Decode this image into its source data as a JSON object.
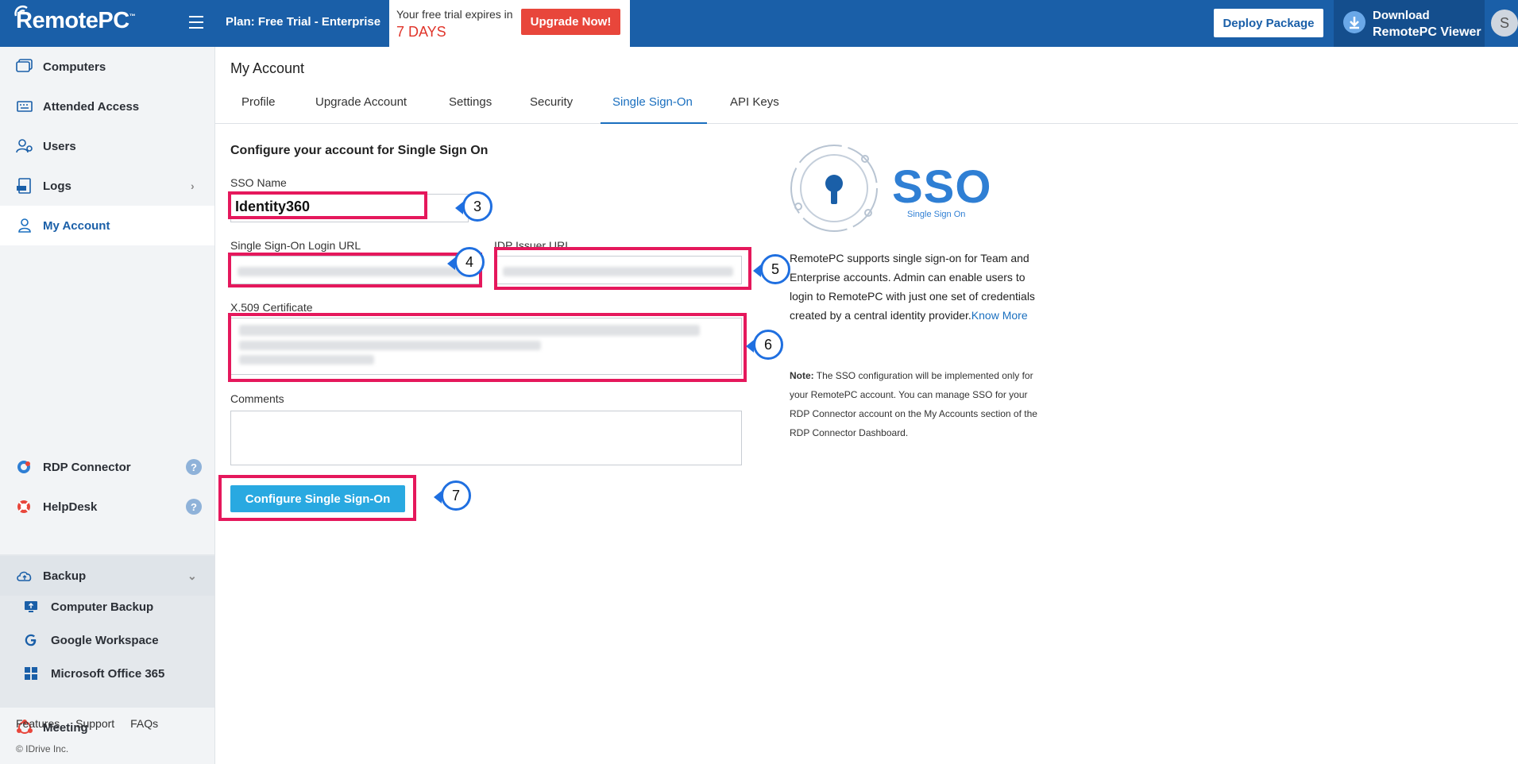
{
  "header": {
    "logo_text": "RemotePC",
    "logo_tm": "™",
    "plan_label": "Plan: Free Trial - Enterprise",
    "trial_text": "Your free trial expires in",
    "trial_days": "7 DAYS",
    "upgrade_label": "Upgrade Now!",
    "deploy_label": "Deploy Package",
    "download_line1": "Download",
    "download_line2": "RemotePC Viewer",
    "avatar_initial": "S"
  },
  "sidebar": {
    "items": [
      {
        "label": "Computers",
        "icon": "monitor-icon"
      },
      {
        "label": "Attended Access",
        "icon": "keyboard-icon"
      },
      {
        "label": "Users",
        "icon": "users-gear-icon"
      },
      {
        "label": "Logs",
        "icon": "logs-icon"
      },
      {
        "label": "My Account",
        "icon": "user-icon"
      },
      {
        "label": "RDP Connector",
        "icon": "rdp-icon"
      },
      {
        "label": "HelpDesk",
        "icon": "helpdesk-icon"
      },
      {
        "label": "Backup",
        "icon": "cloud-upload-icon"
      },
      {
        "label": "Meeting",
        "icon": "meeting-icon"
      }
    ],
    "backup_items": [
      {
        "label": "Computer Backup",
        "icon": "computer-backup-icon"
      },
      {
        "label": "Google Workspace",
        "icon": "google-icon"
      },
      {
        "label": "Microsoft Office 365",
        "icon": "windows-icon"
      }
    ],
    "footer_links": [
      "Features",
      "Support",
      "FAQs"
    ],
    "copyright": "© IDrive Inc."
  },
  "main": {
    "page_title": "My Account",
    "tabs": [
      "Profile",
      "Upgrade Account",
      "Settings",
      "Security",
      "Single Sign-On",
      "API Keys"
    ],
    "active_tab": "Single Sign-On",
    "section_title": "Configure your account for Single Sign On",
    "sso_name_label": "SSO Name",
    "sso_name_value": "Identity360",
    "login_url_label": "Single Sign-On Login URL",
    "idp_issuer_label": "IDP Issuer URL",
    "certificate_label": "X.509 Certificate",
    "comments_label": "Comments",
    "configure_button": "Configure Single Sign-On",
    "callouts": [
      "3",
      "4",
      "5",
      "6",
      "7"
    ],
    "sso_logo_text": "SSO",
    "sso_logo_sub": "Single Sign On",
    "description": "RemotePC supports single sign-on for Team and Enterprise accounts. Admin can enable users to login to RemotePC with just one set of credentials created by a central identity provider.",
    "know_more": "Know More",
    "note_label": "Note:",
    "note_text": " The SSO configuration will be implemented only for your RemotePC account. You can manage SSO for your RDP Connector account on the My Accounts section of the RDP Connector Dashboard."
  },
  "colors": {
    "header_bg": "#1a5fa8",
    "accent": "#1a6fbf",
    "upgrade_red": "#e8463b",
    "highlight_pink": "#e5185c",
    "callout_blue": "#1f6fe0",
    "button_cyan": "#29a9e1"
  }
}
